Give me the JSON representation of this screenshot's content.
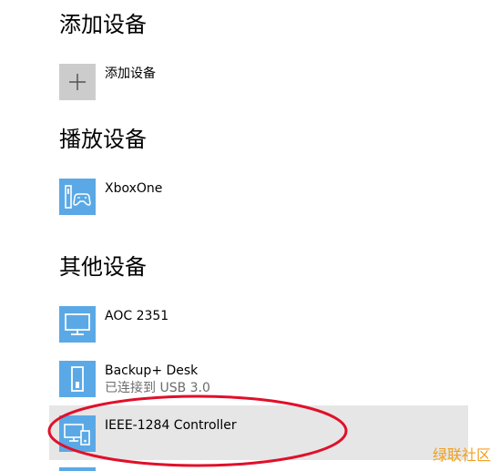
{
  "sections": {
    "add": {
      "heading": "添加设备",
      "item": {
        "label": "添加设备",
        "icon": "plus-icon"
      }
    },
    "playback": {
      "heading": "播放设备",
      "items": [
        {
          "name": "XboxOne",
          "icon": "xbox-console-icon"
        }
      ]
    },
    "other": {
      "heading": "其他设备",
      "items": [
        {
          "name": "AOC 2351",
          "icon": "monitor-icon"
        },
        {
          "name": "Backup+  Desk",
          "status": "已连接到 USB 3.0",
          "icon": "drive-icon"
        },
        {
          "name": "IEEE-1284 Controller",
          "icon": "computer-device-icon"
        }
      ]
    }
  },
  "annotation": {
    "color": "#e0102a",
    "shape": "ellipse"
  },
  "watermark": {
    "text": "绿联社区",
    "color": "#f0a020"
  },
  "colors": {
    "tile": "#5aa9e6",
    "add_tile": "#cccccc",
    "highlight": "#e6e6e6"
  }
}
